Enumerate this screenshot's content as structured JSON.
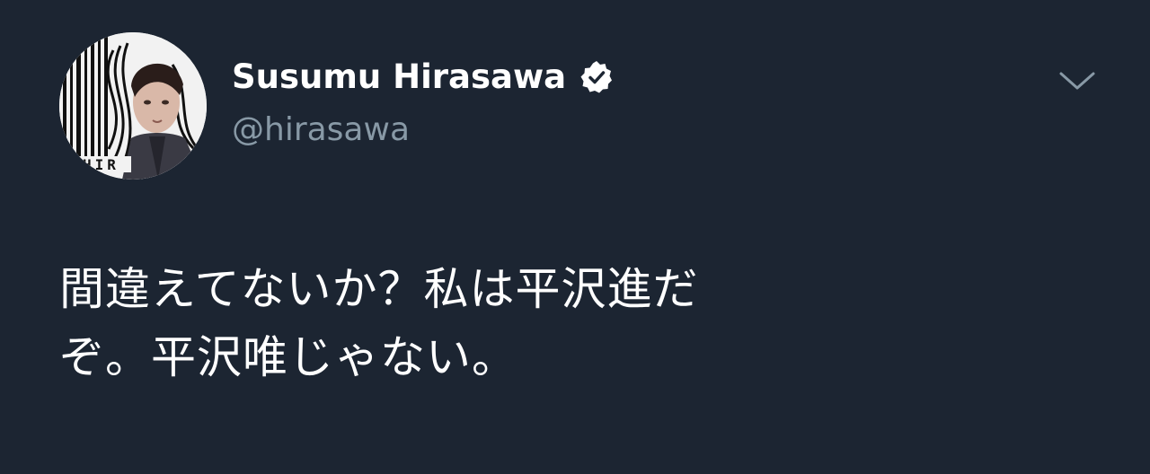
{
  "tweet": {
    "author": {
      "display_name": "Susumu Hirasawa",
      "handle": "@hirasawa",
      "verified_icon": "verified-badge-icon",
      "avatar_text": "HIR"
    },
    "menu_icon": "chevron-down-icon",
    "text_lines": [
      "間違えてないか？私は平沢進だ",
      "ぞ。平沢唯じゃない。"
    ]
  },
  "colors": {
    "background": "#1c2532",
    "text_primary": "#ffffff",
    "text_secondary": "#8899a6"
  }
}
